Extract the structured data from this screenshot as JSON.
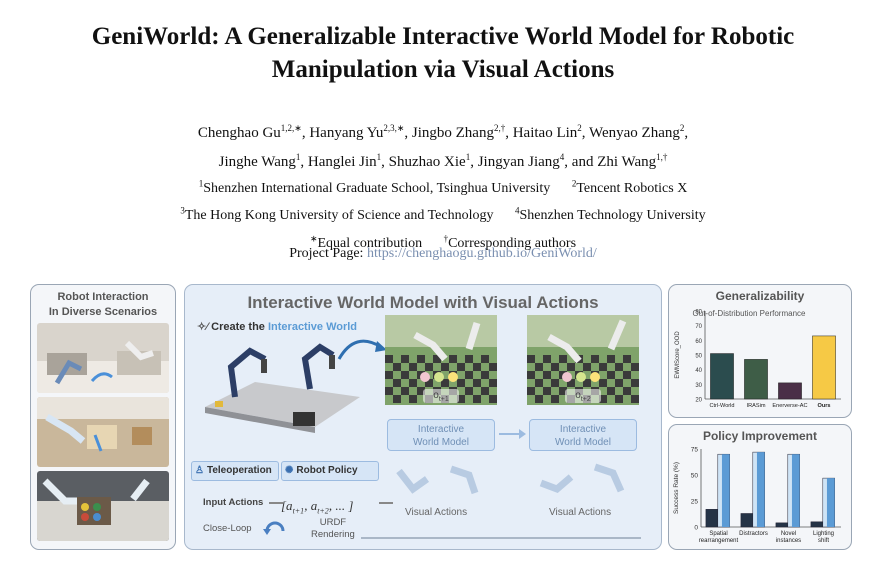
{
  "paper": {
    "title_line1": "GeniWorld: A Generalizable Interactive World Model for Robotic",
    "title_line2": "Manipulation via Visual Actions",
    "authors": [
      {
        "name": "Chenghao Gu",
        "marks": "1,2,∗",
        "sep": ", "
      },
      {
        "name": "Hanyang Yu",
        "marks": "2,3,∗",
        "sep": ", "
      },
      {
        "name": "Jingbo Zhang",
        "marks": "2,†",
        "sep": ", "
      },
      {
        "name": "Haitao Lin",
        "marks": "2",
        "sep": ", "
      },
      {
        "name": "Wenyao Zhang",
        "marks": "2",
        "sep": ","
      },
      {
        "name": "Jinghe Wang",
        "marks": "1",
        "sep": ", "
      },
      {
        "name": "Hanglei Jin",
        "marks": "1",
        "sep": ", "
      },
      {
        "name": "Shuzhao Xie",
        "marks": "1",
        "sep": ", "
      },
      {
        "name": "Jingyan Jiang",
        "marks": "4",
        "sep": ", and "
      },
      {
        "name": "Zhi Wang",
        "marks": "1,†",
        "sep": ""
      }
    ],
    "affiliations": {
      "a1_mark": "1",
      "a1": "Shenzhen International Graduate School, Tsinghua University",
      "a2_mark": "2",
      "a2": "Tencent Robotics X",
      "a3_mark": "3",
      "a3": "The Hong Kong University of Science and Technology",
      "a4_mark": "4",
      "a4": "Shenzhen Technology University",
      "eq_mark": "∗",
      "eq": "Equal contribution",
      "corr_mark": "†",
      "corr": "Corresponding authors"
    },
    "project_label": "Project Page: ",
    "project_url": "https://chenghaogu.github.io/GeniWorld/"
  },
  "figure": {
    "left_panel": {
      "title_line1": "Robot Interaction",
      "title_line2": "In Diverse Scenarios"
    },
    "middle_panel": {
      "title": "Interactive World Model with Visual Actions",
      "create_label": "Create the ",
      "create_highlight": "Interactive World",
      "frame1_label": "o",
      "frame1_sub": "t+1",
      "frame2_label": "o",
      "frame2_sub": "t+2",
      "model_box1_line1": "Interactive",
      "model_box1_line2": "World Model",
      "model_box2_line1": "Interactive",
      "model_box2_line2": "World Model",
      "teleop_label": "Teleoperation",
      "policy_label": "Robot Policy",
      "input_actions_label": "Input Actions",
      "actions_seq": "[a",
      "actions_sub1": "t+1",
      "actions_mid": ", a",
      "actions_sub2": "t+2",
      "actions_end": ", ... ]",
      "visual_actions1": "Visual Actions",
      "visual_actions2": "Visual Actions",
      "closeloop_label": "Close-Loop",
      "urdf_line1": "URDF",
      "urdf_line2": "Rendering"
    },
    "colors": {
      "accent_blue": "#4a7fc1",
      "highlight_blue": "#5b9bd5",
      "panel_border": "#9aa6b5"
    }
  },
  "chart_data": [
    {
      "type": "bar",
      "title": "Generalizability",
      "subtitle": "Out-of-Distribution Performance",
      "ylabel": "EWMScore_OOD",
      "ylim": [
        20,
        80
      ],
      "yticks": [
        20,
        30,
        40,
        50,
        60,
        70,
        80
      ],
      "categories": [
        "Ctrl-World",
        "IRASim",
        "Enerverse-AC",
        "Ours"
      ],
      "values": [
        51,
        47,
        31,
        63
      ],
      "colors": [
        "#2b4c4e",
        "#3e5d47",
        "#4a2f47",
        "#f6c945"
      ],
      "grid": false
    },
    {
      "type": "bar",
      "title": "Policy Improvement",
      "ylabel": "Success Rate (%)",
      "ylim": [
        0,
        75
      ],
      "yticks": [
        0,
        25,
        50,
        75
      ],
      "categories": [
        "Spatial\nrearrangement",
        "Distractors",
        "Novel\ninstances",
        "Lighting\nshift"
      ],
      "series": [
        {
          "values": [
            17,
            13,
            4,
            5
          ],
          "color": "#253447"
        },
        {
          "values": [
            70,
            72,
            70,
            47
          ],
          "color": "#5b9bd5"
        }
      ],
      "grid": false
    }
  ]
}
